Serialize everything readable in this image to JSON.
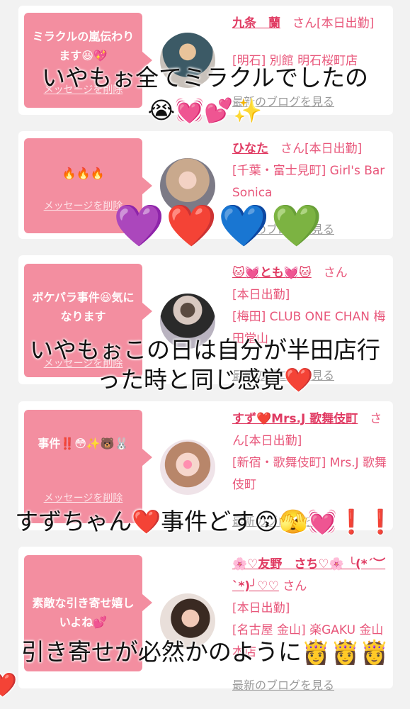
{
  "cards": [
    {
      "message": "ミラクルの嵐伝わります😆💖",
      "delete": "メッセージを削除",
      "name": "九条　蘭",
      "san": "さん",
      "status": "[本日出勤]",
      "location": "[明石] 別館 明石桜町店",
      "blog": "最新のブログを見る"
    },
    {
      "message": "🔥🔥🔥",
      "delete": "メッセージを削除",
      "name": "ひなた",
      "san": "さん",
      "status": "[本日出勤]",
      "location": "[千葉・富士見町] Girl's Bar Sonica",
      "blog": "最新のブログを見る"
    },
    {
      "message": "ボケパラ事件😆気になります",
      "delete": "メッセージを削除",
      "name": "🐱💓とも💓🐱",
      "san": "さん",
      "status": "[本日出勤]",
      "location": "[梅田] CLUB ONE CHAN 梅田堂山",
      "blog": "最新のブログを見る"
    },
    {
      "message": "事件‼️😳✨🐻🐰",
      "delete": "メッセージを削除",
      "name": "すず❤️Mrs.J 歌舞伎町",
      "san": "さん",
      "status": "[本日出勤]",
      "location": "[新宿・歌舞伎町] Mrs.J 歌舞伎町",
      "blog": "最新のブログを見る"
    },
    {
      "message": "素敵な引き寄せ嬉しいよね💕",
      "delete": "メッセージを削除",
      "name": "🌸♡友野　さち♡🌸 ╰(*´︶`*)╯♡♡",
      "san": "さん",
      "status": "[本日出勤]",
      "location": "[名古屋 金山] 楽GAKU 金山本店",
      "blog": "最新のブログを見る"
    }
  ],
  "overlays": {
    "o1_line1": "いやもぉ全てミラクルでしたの",
    "o1_line2": "😭💓💕✨",
    "hearts": "💜❤️💙💚",
    "o2_line1": "いやもぉこの日は自分が半田店行",
    "o2_line2": "った時と同じ感覚❤️",
    "o3": "すずちゃん❤️事件どす😙🫣💓❗️❗️",
    "o4_line1": "引き寄せが必然かのように👸👸👸",
    "o4_line2": "❤️"
  }
}
